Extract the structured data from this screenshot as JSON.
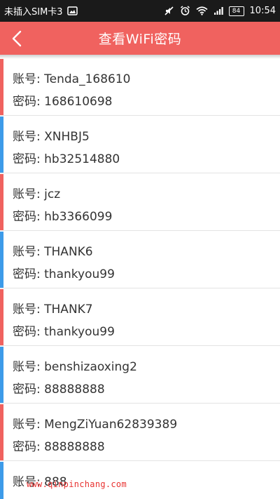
{
  "status_bar": {
    "carrier": "未插入SIM卡3",
    "battery": "84",
    "time": "10:54"
  },
  "app_bar": {
    "title": "查看WiFi密码"
  },
  "colors": {
    "app_bar": "#f0625f",
    "accent_red": "#f0625f",
    "accent_blue": "#3d9be9"
  },
  "wifi_list": [
    {
      "account_label": "账号:",
      "account": "Tenda_168610",
      "password_label": "密码:",
      "password": "168610698",
      "color": "#f0625f"
    },
    {
      "account_label": "账号:",
      "account": "XNHBJ5",
      "password_label": "密码:",
      "password": "hb32514880",
      "color": "#3d9be9"
    },
    {
      "account_label": "账号:",
      "account": "jcz",
      "password_label": "密码:",
      "password": "hb3366099",
      "color": "#f0625f"
    },
    {
      "account_label": "账号:",
      "account": "THANK6",
      "password_label": "密码:",
      "password": "thankyou99",
      "color": "#3d9be9"
    },
    {
      "account_label": "账号:",
      "account": "THANK7",
      "password_label": "密码:",
      "password": "thankyou99",
      "color": "#f0625f"
    },
    {
      "account_label": "账号:",
      "account": "benshizaoxing2",
      "password_label": "密码:",
      "password": "88888888",
      "color": "#3d9be9"
    },
    {
      "account_label": "账号:",
      "account": "MengZiYuan62839389",
      "password_label": "密码:",
      "password": "88888888",
      "color": "#f0625f"
    },
    {
      "account_label": "账号:",
      "account": "888",
      "password_label": "",
      "password": "",
      "color": "#3d9be9"
    }
  ],
  "watermark": "www.qinpinchang.com"
}
